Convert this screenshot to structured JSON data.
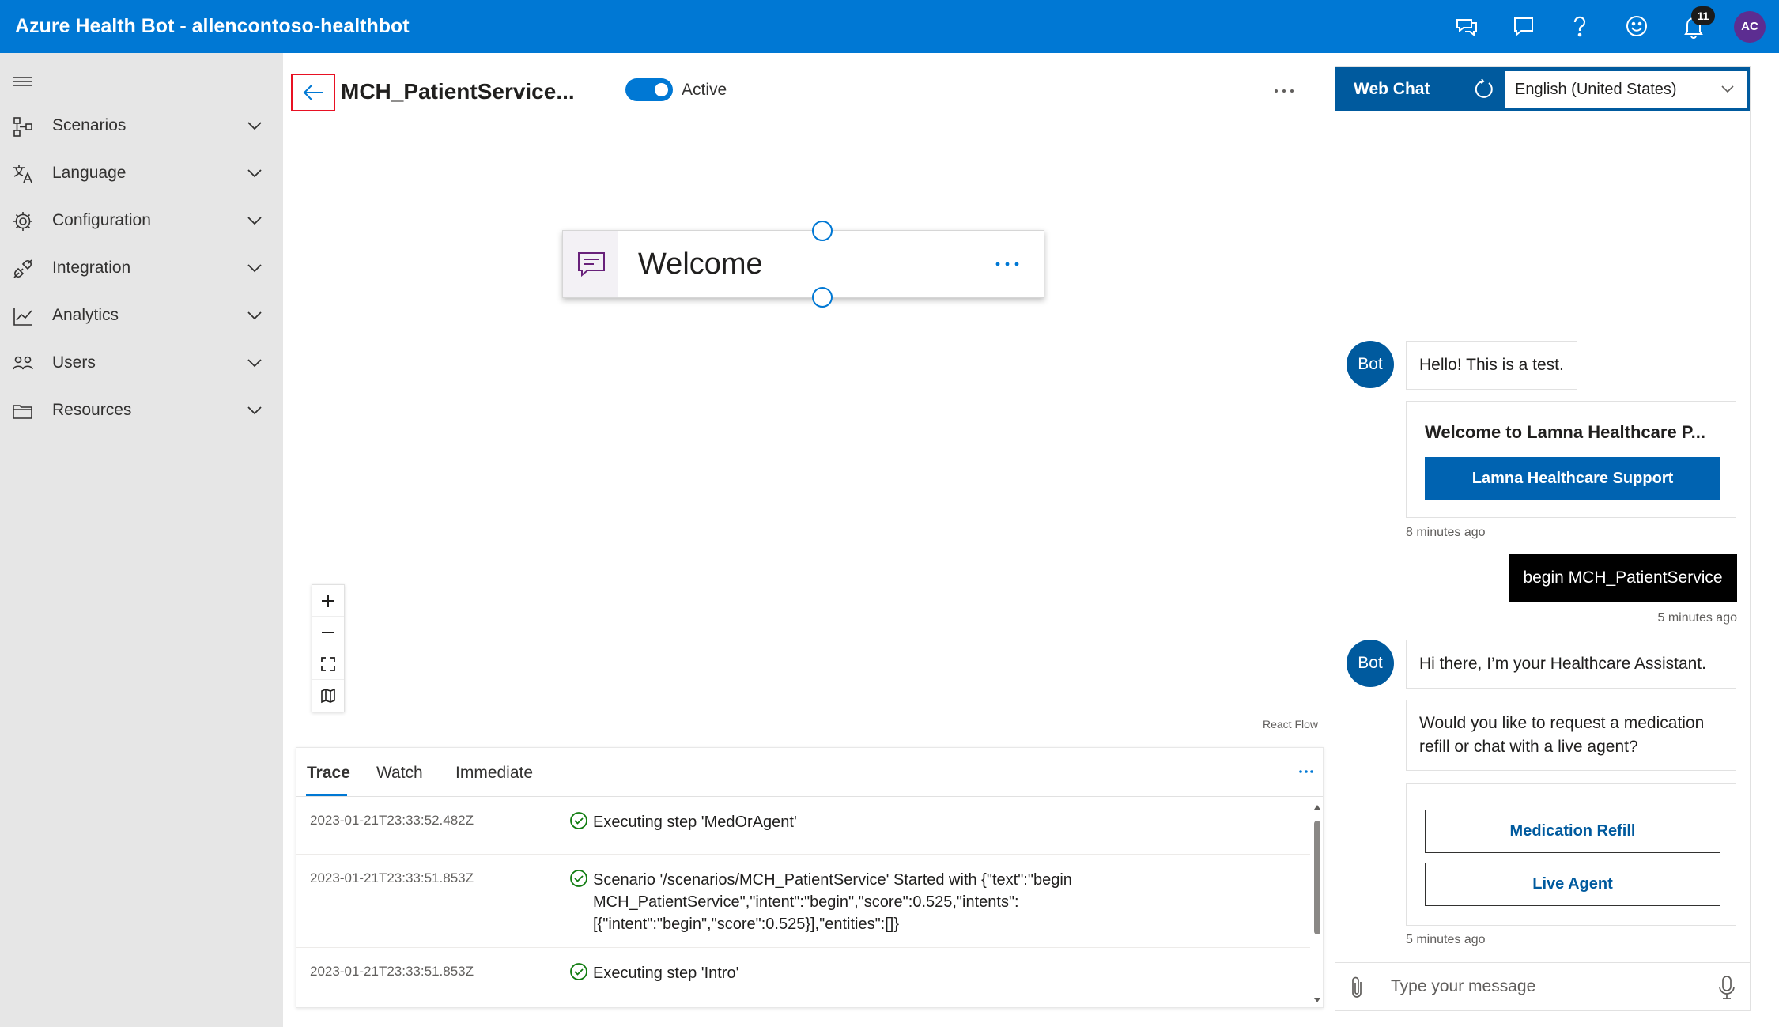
{
  "topbar": {
    "title": "Azure Health Bot - allencontoso-healthbot",
    "icons": [
      "feedback-icon",
      "chat-icon",
      "help-icon",
      "smiley-icon",
      "bell-icon"
    ],
    "notification_count": "11",
    "avatar_initials": "AC",
    "color": "#0078d4"
  },
  "sidebar": {
    "items": [
      {
        "label": "Scenarios",
        "icon": "scenarios-icon"
      },
      {
        "label": "Language",
        "icon": "language-icon"
      },
      {
        "label": "Configuration",
        "icon": "gear-icon"
      },
      {
        "label": "Integration",
        "icon": "plug-icon"
      },
      {
        "label": "Analytics",
        "icon": "analytics-icon"
      },
      {
        "label": "Users",
        "icon": "users-icon"
      },
      {
        "label": "Resources",
        "icon": "folder-icon"
      }
    ]
  },
  "editor": {
    "scenario_title": "MCH_PatientService...",
    "status_label": "Active",
    "status_on": true,
    "node": {
      "label": "Welcome",
      "icon": "message-icon"
    },
    "attribution": "React Flow"
  },
  "debug": {
    "tabs": [
      {
        "label": "Trace",
        "active": true
      },
      {
        "label": "Watch",
        "active": false
      },
      {
        "label": "Immediate",
        "active": false
      }
    ],
    "rows": [
      {
        "timestamp": "2023-01-21T23:33:52.482Z",
        "message": "Executing step 'MedOrAgent'"
      },
      {
        "timestamp": "2023-01-21T23:33:51.853Z",
        "message": "Scenario '/scenarios/MCH_PatientService' Started with {\"text\":\"begin MCH_PatientService\",\"intent\":\"begin\",\"score\":0.525,\"intents\":[{\"intent\":\"begin\",\"score\":0.525}],\"entities\":[]}"
      },
      {
        "timestamp": "2023-01-21T23:33:51.853Z",
        "message": "Executing step 'Intro'"
      }
    ]
  },
  "webchat": {
    "title": "Web Chat",
    "language": "English (United States)",
    "bot_label": "Bot",
    "messages": {
      "hello": "Hello! This is a test.",
      "card_title": "Welcome to Lamna Healthcare P...",
      "card_button": "Lamna Healthcare Support",
      "time_1": "8 minutes ago",
      "user_msg": "begin MCH_PatientService",
      "time_2": "5 minutes ago",
      "greeting": "Hi there, I’m your Healthcare Assistant.",
      "question": "Would you like to request a medication refill or chat with a live agent?",
      "option_1": "Medication Refill",
      "option_2": "Live Agent",
      "time_3": "5 minutes ago"
    },
    "input_placeholder": "Type your message",
    "accent": "#005a9e"
  }
}
